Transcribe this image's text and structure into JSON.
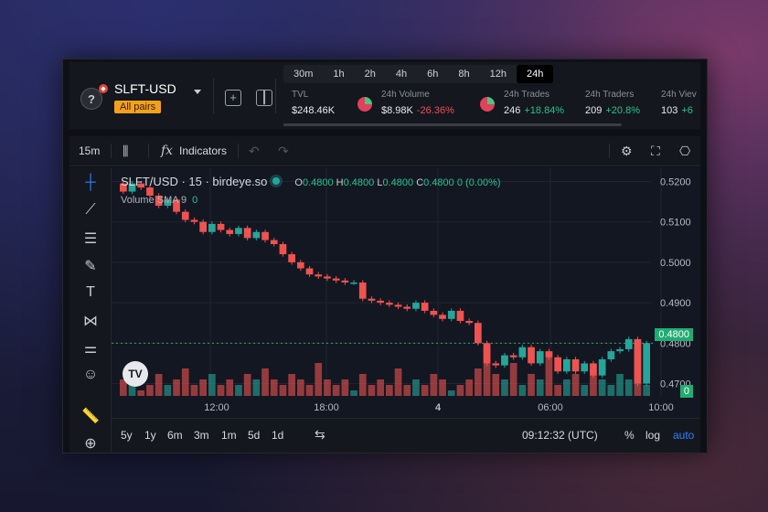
{
  "header": {
    "pair": "SLFT-USD",
    "all_pairs": "All pairs",
    "timeframes": [
      "30m",
      "1h",
      "2h",
      "4h",
      "6h",
      "8h",
      "12h",
      "24h"
    ],
    "active_timeframe": "24h",
    "stats": {
      "tvl": {
        "label": "TVL",
        "value": "$248.46K"
      },
      "volume": {
        "label": "24h Volume",
        "value": "$8.98K",
        "change": "-26.36%"
      },
      "trades": {
        "label": "24h Trades",
        "value": "246",
        "change": "+18.84%"
      },
      "traders": {
        "label": "24h Traders",
        "value": "209",
        "change": "+20.8%"
      },
      "views": {
        "label": "24h Viev",
        "value": "103",
        "change": "+6"
      }
    }
  },
  "toolbar": {
    "interval": "15m",
    "indicators": "Indicators"
  },
  "chart": {
    "symbol_line": "SLFT/USD · 15 · birdeye.so",
    "ohlc": {
      "o": "0.4800",
      "h": "0.4800",
      "l": "0.4800",
      "c": "0.4800",
      "chg": "0 (0.00%)"
    },
    "volume_label": "Volume",
    "volume_sma": "SMA 9",
    "volume_value": "0",
    "last_price": "0.4800",
    "last_volume": "0",
    "price_ticks": [
      "0.5200",
      "0.5100",
      "0.5000",
      "0.4900",
      "0.4800",
      "0.4700"
    ],
    "time_ticks": [
      "12:00",
      "18:00",
      "4",
      "06:00",
      "10:00"
    ]
  },
  "bottom": {
    "ranges": [
      "5y",
      "1y",
      "6m",
      "3m",
      "1m",
      "5d",
      "1d"
    ],
    "clock": "09:12:32 (UTC)",
    "percent": "%",
    "log": "log",
    "auto": "auto"
  },
  "chart_data": {
    "type": "candlestick",
    "yaxis_ticks": [
      0.52,
      0.51,
      0.5,
      0.49,
      0.48,
      0.47
    ],
    "ylim": [
      0.4665,
      0.5235
    ],
    "series": [
      {
        "o": 0.5195,
        "c": 0.5175
      },
      {
        "o": 0.5175,
        "c": 0.5195
      },
      {
        "o": 0.5195,
        "c": 0.5185
      },
      {
        "o": 0.5185,
        "c": 0.5165
      },
      {
        "o": 0.5165,
        "c": 0.514
      },
      {
        "o": 0.514,
        "c": 0.5155
      },
      {
        "o": 0.5155,
        "c": 0.5125
      },
      {
        "o": 0.5125,
        "c": 0.5105
      },
      {
        "o": 0.5105,
        "c": 0.51
      },
      {
        "o": 0.51,
        "c": 0.5075
      },
      {
        "o": 0.5075,
        "c": 0.5095
      },
      {
        "o": 0.5095,
        "c": 0.508
      },
      {
        "o": 0.508,
        "c": 0.507
      },
      {
        "o": 0.507,
        "c": 0.5085
      },
      {
        "o": 0.5085,
        "c": 0.506
      },
      {
        "o": 0.506,
        "c": 0.5075
      },
      {
        "o": 0.5075,
        "c": 0.5055
      },
      {
        "o": 0.5055,
        "c": 0.5045
      },
      {
        "o": 0.5045,
        "c": 0.502
      },
      {
        "o": 0.502,
        "c": 0.5
      },
      {
        "o": 0.5,
        "c": 0.4985
      },
      {
        "o": 0.4985,
        "c": 0.497
      },
      {
        "o": 0.497,
        "c": 0.4965
      },
      {
        "o": 0.4965,
        "c": 0.496
      },
      {
        "o": 0.496,
        "c": 0.4955
      },
      {
        "o": 0.4955,
        "c": 0.495
      },
      {
        "o": 0.495,
        "c": 0.495
      },
      {
        "o": 0.495,
        "c": 0.491
      },
      {
        "o": 0.491,
        "c": 0.4905
      },
      {
        "o": 0.4905,
        "c": 0.49
      },
      {
        "o": 0.49,
        "c": 0.4895
      },
      {
        "o": 0.4895,
        "c": 0.489
      },
      {
        "o": 0.489,
        "c": 0.4885
      },
      {
        "o": 0.4885,
        "c": 0.49
      },
      {
        "o": 0.49,
        "c": 0.488
      },
      {
        "o": 0.488,
        "c": 0.487
      },
      {
        "o": 0.487,
        "c": 0.486
      },
      {
        "o": 0.486,
        "c": 0.488
      },
      {
        "o": 0.488,
        "c": 0.4855
      },
      {
        "o": 0.4855,
        "c": 0.485
      },
      {
        "o": 0.485,
        "c": 0.48
      },
      {
        "o": 0.48,
        "c": 0.475
      },
      {
        "o": 0.475,
        "c": 0.4745
      },
      {
        "o": 0.4745,
        "c": 0.477
      },
      {
        "o": 0.477,
        "c": 0.4765
      },
      {
        "o": 0.4765,
        "c": 0.479
      },
      {
        "o": 0.479,
        "c": 0.475
      },
      {
        "o": 0.475,
        "c": 0.478
      },
      {
        "o": 0.478,
        "c": 0.4765
      },
      {
        "o": 0.4765,
        "c": 0.473
      },
      {
        "o": 0.473,
        "c": 0.476
      },
      {
        "o": 0.476,
        "c": 0.473
      },
      {
        "o": 0.473,
        "c": 0.475
      },
      {
        "o": 0.475,
        "c": 0.472
      },
      {
        "o": 0.472,
        "c": 0.476
      },
      {
        "o": 0.476,
        "c": 0.478
      },
      {
        "o": 0.478,
        "c": 0.4785
      },
      {
        "o": 0.4785,
        "c": 0.481
      },
      {
        "o": 0.481,
        "c": 0.47
      },
      {
        "o": 0.47,
        "c": 0.48
      }
    ],
    "volumes": [
      3,
      2,
      1,
      2,
      4,
      2,
      3,
      5,
      2,
      3,
      4,
      2,
      3,
      2,
      4,
      3,
      5,
      3,
      2,
      4,
      3,
      2,
      6,
      3,
      2,
      3,
      1,
      4,
      2,
      3,
      2,
      5,
      2,
      3,
      2,
      4,
      3,
      1,
      2,
      3,
      5,
      9,
      4,
      3,
      6,
      2,
      4,
      3,
      8,
      2,
      3,
      4,
      2,
      5,
      3,
      2,
      4,
      3,
      10,
      2
    ],
    "xlabel": "",
    "ylabel": ""
  }
}
